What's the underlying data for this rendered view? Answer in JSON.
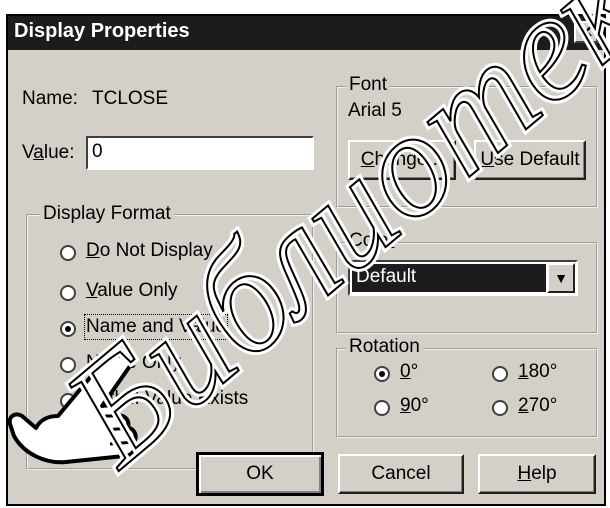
{
  "dialog": {
    "title": "Display Properties",
    "close_glyph": "✕",
    "name_label": "Name:",
    "name_value": "TCLOSE",
    "value_label_pre": "V",
    "value_label_u": "a",
    "value_label_post": "lue:",
    "value_field": "0"
  },
  "display_format": {
    "label": "Display Format",
    "options": [
      {
        "u": "D",
        "rest": "o Not Display",
        "selected": false
      },
      {
        "u": "V",
        "rest": "alue Only",
        "selected": false
      },
      {
        "u": "",
        "rest": "Name and Value",
        "selected": true
      },
      {
        "u": "",
        "rest": "Name Only",
        "selected": false
      },
      {
        "u": "",
        "rest": "Both if Value Exists",
        "selected": false
      }
    ]
  },
  "font": {
    "label": "Font",
    "current": "Arial 5",
    "change_u": "C",
    "change_rest": "hange...",
    "use_default_u": "U",
    "use_default_rest": "se Default"
  },
  "color": {
    "label_pre": "Colo",
    "label_u": "r",
    "selected": "Default"
  },
  "rotation": {
    "label": "Rotation",
    "options": [
      {
        "u": "0",
        "rest": "°",
        "selected": true
      },
      {
        "u": "1",
        "rest": "80°",
        "selected": false
      },
      {
        "u": "9",
        "rest": "0°",
        "selected": false
      },
      {
        "u": "2",
        "rest": "70°",
        "selected": false
      }
    ]
  },
  "buttons": {
    "ok": "OK",
    "cancel": "Cancel",
    "help_u": "H",
    "help_rest": "elp"
  },
  "watermark": "Библиотека"
}
